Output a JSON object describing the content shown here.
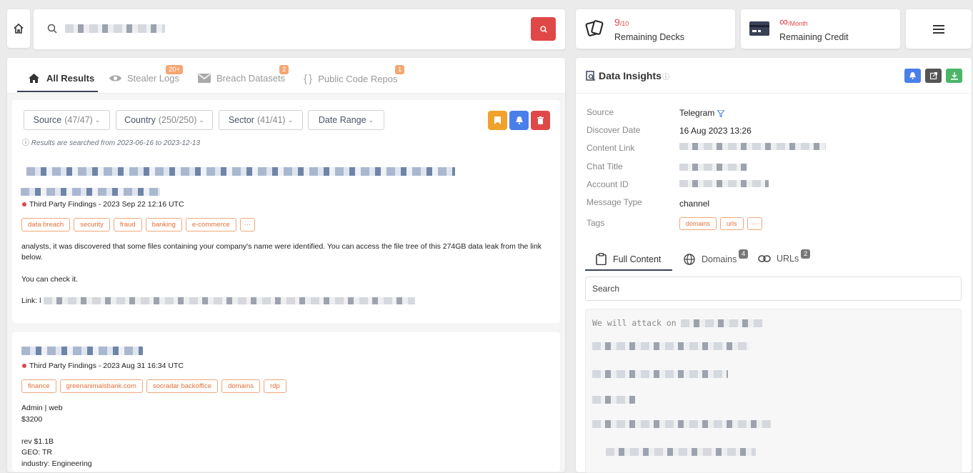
{
  "search": {
    "placeholder": ""
  },
  "stats": {
    "decks_value": "9",
    "decks_total": "/10",
    "decks_label": "Remaining Decks",
    "credit_value": "∞",
    "credit_unit": "/Month",
    "credit_label": "Remaining Credit"
  },
  "tabs": [
    {
      "label": "All Results"
    },
    {
      "label": "Stealer Logs",
      "badge": "20+"
    },
    {
      "label": "Breach Datasets",
      "badge": "2"
    },
    {
      "label": "Public Code Repos",
      "badge": "1"
    }
  ],
  "filters": {
    "source_label": "Source",
    "source_count": "(47/47)",
    "country_label": "Country",
    "country_count": "(250/250)",
    "sector_label": "Sector",
    "sector_count": "(41/41)",
    "date_label": "Date Range",
    "note": "Results are searched from 2023-06-16 to 2023-12-13"
  },
  "results": [
    {
      "finding": "Third Party Findings - 2023 Sep 22 12:16 UTC",
      "tags": [
        "data breach",
        "security",
        "fraud",
        "banking",
        "e-commerce",
        "···"
      ],
      "body1": "analysts, it was discovered that some files containing your company's name were identified. You can access the file tree of this 274GB data leak from the link below.",
      "body2": "You can check it.",
      "link_label": "Link: l"
    },
    {
      "finding": "Third Party Findings - 2023 Aug 31 16:34 UTC",
      "tags": [
        "finance",
        "greenanimalsbank.com",
        "socradar backoffice",
        "domains",
        "rdp"
      ],
      "lines": [
        "Admin | web",
        "$3200",
        "",
        "rev $1.1B",
        "GEO: TR",
        "industry: Engineering"
      ]
    }
  ],
  "insights": {
    "title": "Data Insights",
    "labels": {
      "source": "Source",
      "discover_date": "Discover Date",
      "content_link": "Content Link",
      "chat_title": "Chat Title",
      "account_id": "Account ID",
      "message_type": "Message Type",
      "tags": "Tags"
    },
    "values": {
      "source": "Telegram",
      "discover_date": "16 Aug 2023 13:26",
      "message_type": "channel"
    },
    "tags": [
      "domains",
      "urls",
      "···"
    ],
    "content_tabs": [
      {
        "label": "Full Content"
      },
      {
        "label": "Domains",
        "badge": "4"
      },
      {
        "label": "URLs",
        "badge": "2"
      }
    ],
    "search_placeholder": "Search",
    "content_first_line": "We will attack on"
  }
}
